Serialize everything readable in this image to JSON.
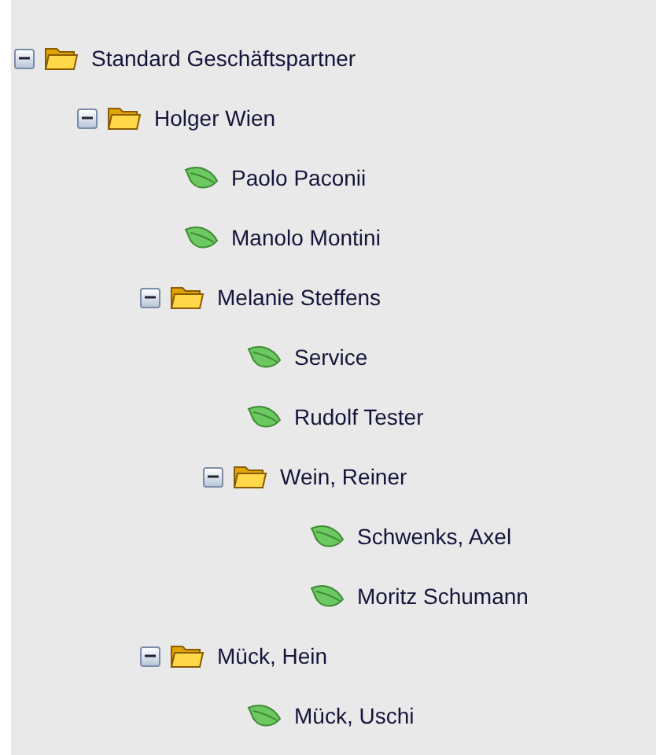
{
  "tree": [
    {
      "kind": "folder",
      "label": "Standard Geschäftspartner",
      "expanded": true,
      "children": [
        {
          "kind": "folder",
          "label": "Holger Wien",
          "expanded": true,
          "children": [
            {
              "kind": "leaf",
              "label": "Paolo Paconii"
            },
            {
              "kind": "leaf",
              "label": "Manolo Montini"
            },
            {
              "kind": "folder",
              "label": "Melanie Steffens",
              "expanded": true,
              "children": [
                {
                  "kind": "leaf",
                  "label": "Service"
                },
                {
                  "kind": "leaf",
                  "label": "Rudolf Tester"
                },
                {
                  "kind": "folder",
                  "label": "Wein, Reiner",
                  "expanded": true,
                  "children": [
                    {
                      "kind": "leaf",
                      "label": "Schwenks, Axel"
                    },
                    {
                      "kind": "leaf",
                      "label": "Moritz Schumann"
                    }
                  ]
                }
              ]
            },
            {
              "kind": "folder",
              "label": "Mück, Hein",
              "expanded": true,
              "children": [
                {
                  "kind": "leaf",
                  "label": "Mück, Uschi"
                }
              ]
            }
          ]
        }
      ]
    }
  ]
}
